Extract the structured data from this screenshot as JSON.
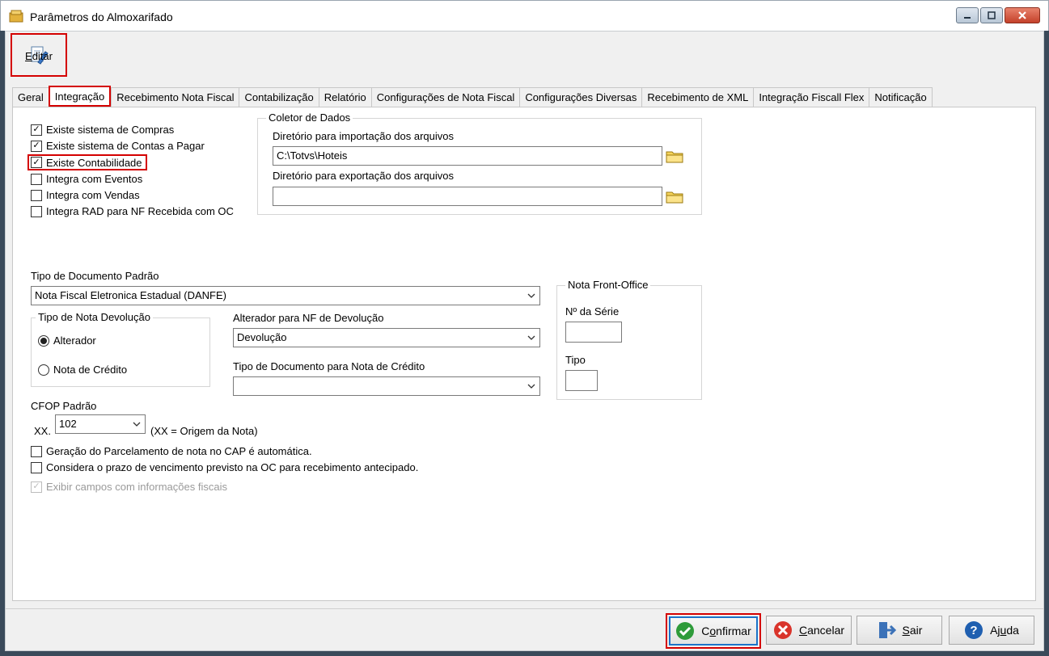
{
  "window": {
    "title": "Parâmetros do Almoxarifado"
  },
  "toolbar": {
    "edit_label_u": "E",
    "edit_label_rest": "ditar"
  },
  "tabs": [
    "Geral",
    "Integração",
    "Recebimento Nota Fiscal",
    "Contabilização",
    "Relatório",
    "Configurações de Nota Fiscal",
    "Configurações Diversas",
    "Recebimento de XML",
    "Integração Fiscall Flex",
    "Notificação"
  ],
  "active_tab": "Integração",
  "integration": {
    "checkboxes": [
      {
        "label": "Existe sistema de Compras",
        "checked": true
      },
      {
        "label": "Existe sistema de Contas a Pagar",
        "checked": true
      },
      {
        "label": "Existe Contabilidade",
        "checked": true
      },
      {
        "label": "Integra com Eventos",
        "checked": false
      },
      {
        "label": "Integra com Vendas",
        "checked": false
      },
      {
        "label": "Integra RAD para NF Recebida com OC",
        "checked": false
      }
    ],
    "coletor": {
      "legend": "Coletor de Dados",
      "import_label": "Diretório para importação dos arquivos",
      "import_value": "C:\\Totvs\\Hoteis",
      "export_label": "Diretório para exportação dos arquivos",
      "export_value": ""
    },
    "tipo_doc_label": "Tipo de Documento Padrão",
    "tipo_doc_value": "Nota Fiscal Eletronica Estadual (DANFE)",
    "devolucao": {
      "legend": "Tipo de Nota Devolução",
      "options": [
        {
          "label": "Alterador",
          "selected": true
        },
        {
          "label": "Nota de Crédito",
          "selected": false
        }
      ]
    },
    "alterador_label": "Alterador para NF de Devolução",
    "alterador_value": "Devolução",
    "tipo_credito_label": "Tipo de Documento para Nota de Crédito",
    "tipo_credito_value": "",
    "front_office": {
      "legend": "Nota Front-Office",
      "serie_label": "Nº da Série",
      "serie_value": "",
      "tipo_label": "Tipo",
      "tipo_value": ""
    },
    "cfop_label": "CFOP Padrão",
    "cfop_prefix": "XX.",
    "cfop_value": "102",
    "cfop_hint": "(XX = Origem da Nota)",
    "bottom_checkboxes": [
      {
        "label": "Geração do Parcelamento de nota no CAP é automática.",
        "checked": false,
        "disabled": false
      },
      {
        "label": "Considera o prazo de vencimento previsto na OC para recebimento antecipado.",
        "checked": false,
        "disabled": false
      },
      {
        "label": "Exibir campos com informações fiscais",
        "checked": true,
        "disabled": true
      }
    ]
  },
  "buttons": {
    "confirm": {
      "u": "o",
      "pre": "C",
      "post": "nfirmar"
    },
    "cancel": {
      "u": "C",
      "pre": "",
      "post": "ancelar"
    },
    "exit": {
      "u": "S",
      "pre": "",
      "post": "air"
    },
    "help": {
      "u": "u",
      "pre": "Aj",
      "post": "da"
    }
  },
  "colors": {
    "highlight": "#d40000",
    "primary_border": "#1b73c9",
    "confirm_icon": "#2e9b3a",
    "cancel_icon": "#d9342b",
    "help_icon": "#1f5fb0"
  }
}
